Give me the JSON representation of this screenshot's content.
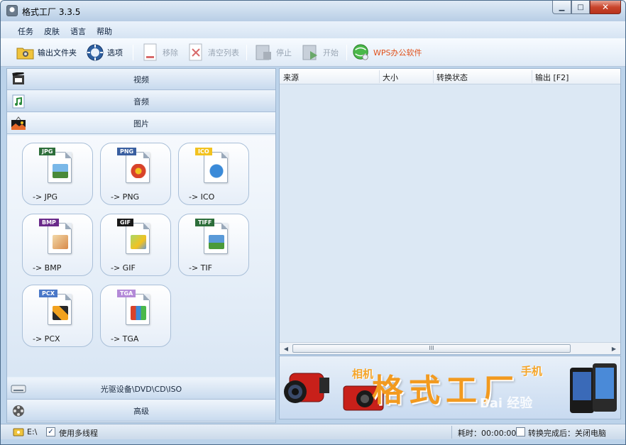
{
  "window": {
    "title": "格式工厂 3.3.5"
  },
  "menu": [
    "任务",
    "皮肤",
    "语言",
    "帮助"
  ],
  "toolbar": {
    "output_folder": "输出文件夹",
    "options": "选项",
    "remove": "移除",
    "clear_list": "清空列表",
    "stop": "停止",
    "start": "开始",
    "wps": "WPS办公软件"
  },
  "categories": {
    "video": "视频",
    "audio": "音频",
    "image": "图片",
    "optical": "光驱设备\\DVD\\CD\\ISO",
    "advanced": "高级"
  },
  "image_formats": [
    {
      "tag": "JPG",
      "label": "-> JPG",
      "color": "#2d6e3a"
    },
    {
      "tag": "PNG",
      "label": "-> PNG",
      "color": "#3a5fa0"
    },
    {
      "tag": "ICO",
      "label": "-> ICO",
      "color": "#f2c21f"
    },
    {
      "tag": "BMP",
      "label": "-> BMP",
      "color": "#6a2a8a"
    },
    {
      "tag": "GIF",
      "label": "-> GIF",
      "color": "#1a1a1a"
    },
    {
      "tag": "TIFF",
      "label": "-> TIF",
      "color": "#2d6e3a"
    },
    {
      "tag": "PCX",
      "label": "-> PCX",
      "color": "#4a78c8"
    },
    {
      "tag": "TGA",
      "label": "-> TGA",
      "color": "#b48ad8"
    }
  ],
  "list_columns": [
    "来源",
    "大小",
    "转换状态",
    "输出 [F2]"
  ],
  "banner": {
    "main": "格式工厂",
    "sub_left": "相机",
    "sub_right": "手机",
    "watermark": "Bai 经验"
  },
  "status": {
    "drive": "E:\\",
    "multithread": "使用多线程",
    "elapsed": "耗时：00:00:00",
    "after_done": "转换完成后：关闭电脑"
  }
}
